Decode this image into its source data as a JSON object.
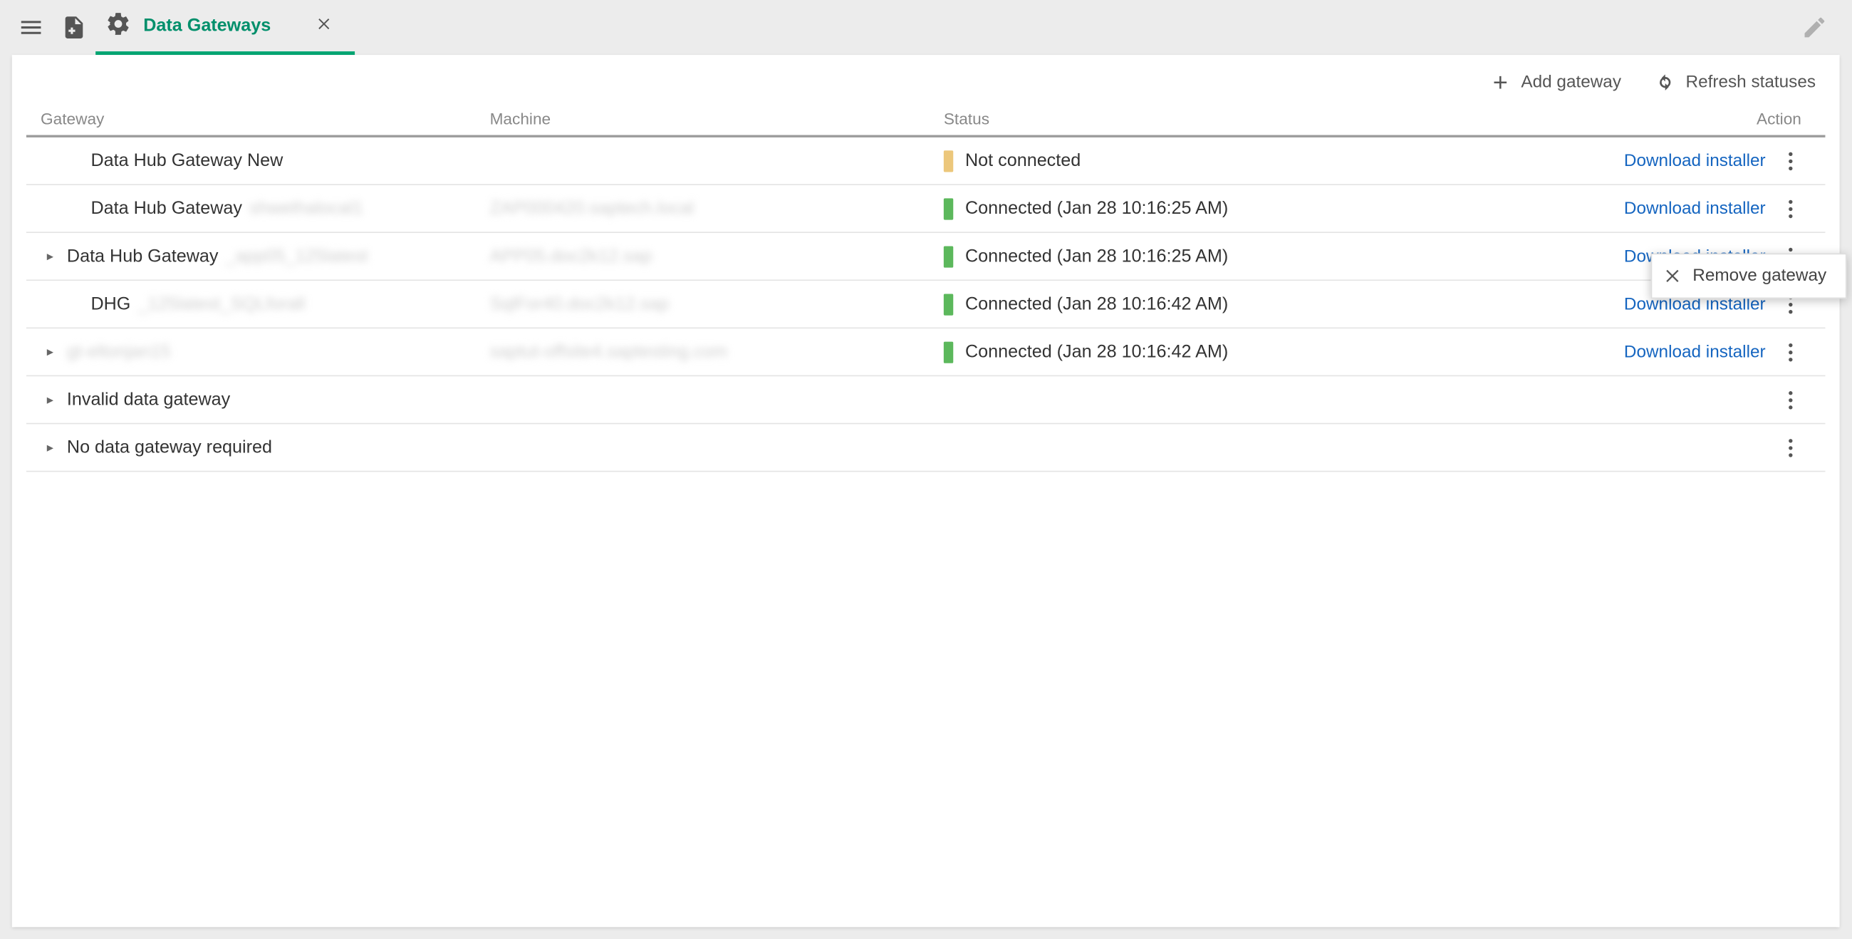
{
  "tab": {
    "title": "Data Gateways"
  },
  "actions": {
    "add_gateway": "Add gateway",
    "refresh": "Refresh statuses"
  },
  "columns": {
    "gateway": "Gateway",
    "machine": "Machine",
    "status": "Status",
    "action": "Action"
  },
  "rows": [
    {
      "expandable": false,
      "gateway": "Data Hub Gateway New",
      "gateway_blur": "",
      "machine_blur": "",
      "status_color": "orange",
      "status_text": "Not connected",
      "download": "Download installer"
    },
    {
      "expandable": false,
      "gateway": "Data Hub Gateway",
      "gateway_blur": "shwethalocal1",
      "machine_blur": "ZAP000420.saptech.local",
      "status_color": "green",
      "status_text": "Connected (Jan 28 10:16:25 AM)",
      "download": "Download installer"
    },
    {
      "expandable": true,
      "gateway": "Data Hub Gateway",
      "gateway_blur": "_app05_125latest",
      "machine_blur": "APP05.doc2k12.sap",
      "status_color": "green",
      "status_text": "Connected (Jan 28 10:16:25 AM)",
      "download": "Download installer"
    },
    {
      "expandable": false,
      "gateway": "DHG",
      "gateway_blur": "_125latest_SQLforall",
      "machine_blur": "SqlFor40.doc2k12.sap",
      "status_color": "green",
      "status_text": "Connected (Jan 28 10:16:42 AM)",
      "download": "Download installer"
    },
    {
      "expandable": true,
      "gateway": "",
      "gateway_blur": "gt-eltonjan15",
      "machine_blur": "saptut-offsite4.saptesting.com",
      "status_color": "green",
      "status_text": "Connected (Jan 28 10:16:42 AM)",
      "download": "Download installer"
    },
    {
      "expandable": true,
      "gateway": "Invalid data gateway",
      "gateway_blur": "",
      "machine_blur": "",
      "status_color": "",
      "status_text": "",
      "download": ""
    },
    {
      "expandable": true,
      "gateway": "No data gateway required",
      "gateway_blur": "",
      "machine_blur": "",
      "status_color": "",
      "status_text": "",
      "download": ""
    }
  ],
  "context_menu": {
    "remove": "Remove gateway"
  }
}
